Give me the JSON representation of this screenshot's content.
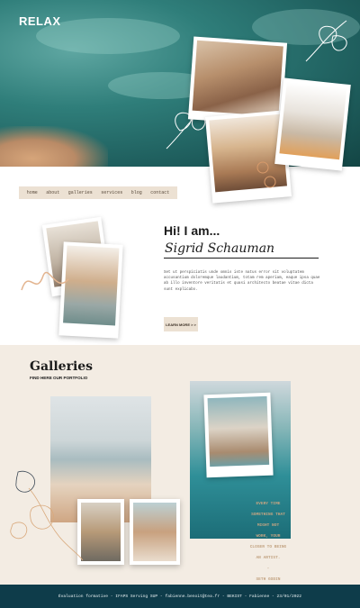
{
  "brand": {
    "logo": "RELAX"
  },
  "nav": {
    "items": [
      {
        "label": "home"
      },
      {
        "label": "about"
      },
      {
        "label": "galleries"
      },
      {
        "label": "services"
      },
      {
        "label": "blog"
      },
      {
        "label": "contact"
      }
    ]
  },
  "about": {
    "heading": "Hi! I am...",
    "name": "Sigrid Schauman",
    "text": "Set ut perspiciatis unde omnis iste natus error sit voluptatem accusantium doloremque laudantium, totam rem aperiam, eaque ipsa quae ab illo inventore veritatis et quasi architecto beatae vitae dicta sunt explicabo.",
    "button_label": "LEARN MORE > >"
  },
  "galleries": {
    "title": "Galleries",
    "subtitle": "FIND HERE OUR PORTFOLIO",
    "quote_lines": [
      "EVERY TIME",
      "SOMETHING THAT",
      "MIGHT NOT",
      "WORK, YOUR",
      "CLOSER TO BEING",
      "AN ARTIST.",
      "-",
      "SETH GODIN"
    ]
  },
  "footer": {
    "text": "Évaluation formative - IFAPS Serving SUP - fabienne.benoit@tea.fr - BEKIST - Fabienne - 23/01/2022"
  },
  "colors": {
    "accent": "#ece1d3",
    "footer_bg": "#0e3c4a",
    "gallery_bg": "#f3ece3",
    "quote": "#c3a483"
  }
}
